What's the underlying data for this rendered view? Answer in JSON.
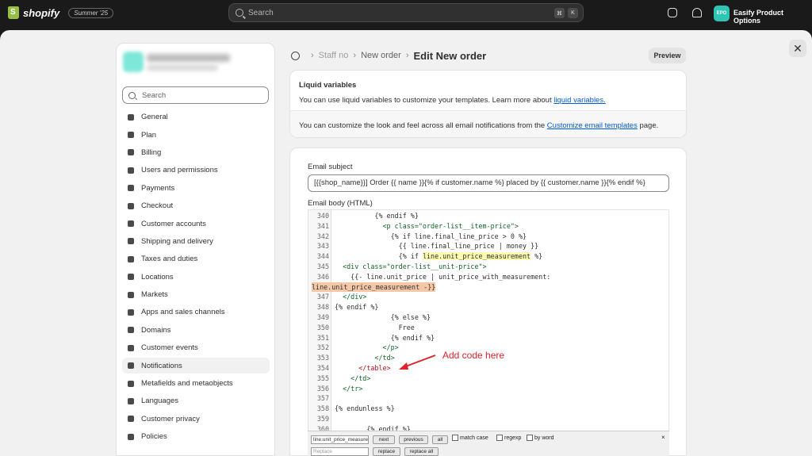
{
  "topbar": {
    "brand": "shopify",
    "edition": "Summer '25",
    "search_placeholder": "Search",
    "kbd_1": "⌘",
    "kbd_2": "K",
    "store_badge": "EPO",
    "store_name": "Easify Product Options"
  },
  "close_label": "✕",
  "sidebar": {
    "search_placeholder": "Search",
    "items": [
      {
        "label": "General"
      },
      {
        "label": "Plan"
      },
      {
        "label": "Billing"
      },
      {
        "label": "Users and permissions"
      },
      {
        "label": "Payments"
      },
      {
        "label": "Checkout"
      },
      {
        "label": "Customer accounts"
      },
      {
        "label": "Shipping and delivery"
      },
      {
        "label": "Taxes and duties"
      },
      {
        "label": "Locations"
      },
      {
        "label": "Markets"
      },
      {
        "label": "Apps and sales channels"
      },
      {
        "label": "Domains"
      },
      {
        "label": "Customer events"
      },
      {
        "label": "Notifications"
      },
      {
        "label": "Metafields and metaobjects"
      },
      {
        "label": "Languages"
      },
      {
        "label": "Customer privacy"
      },
      {
        "label": "Policies"
      }
    ],
    "active_item": "Notifications"
  },
  "header": {
    "crumb_1": "Staff no",
    "crumb_2": "New order",
    "title": "Edit New order",
    "preview_label": "Preview"
  },
  "liquid_card": {
    "title": "Liquid variables",
    "line1_text": "You can use liquid variables to customize your templates. Learn more about ",
    "line1_link": "liquid variables.",
    "line2_text": "You can customize the look and feel across all email notifications from the ",
    "line2_link": "Customize email templates",
    "line2_suffix": " page."
  },
  "email": {
    "subject_label": "Email subject",
    "subject_value": "[{{shop_name}}] Order {{ name }}{% if customer.name %} placed by {{ customer.name }}{% endif %}",
    "body_label": "Email body (HTML)"
  },
  "code_lines": [
    {
      "n": "340",
      "t": "          {% endif %}"
    },
    {
      "n": "341",
      "t": "            <p class=\"order-list__item-price\">"
    },
    {
      "n": "342",
      "t": "              {% if line.final_line_price > 0 %}"
    },
    {
      "n": "343",
      "t": "                {{ line.final_line_price | money }}"
    },
    {
      "n": "344",
      "t": "                {% if line.unit_price_measurement %}"
    },
    {
      "n": "345",
      "t": "  <div class=\"order-list__unit-price\">"
    },
    {
      "n": "346",
      "t": "    {{- line.unit_price | unit_price_with_measurement:"
    },
    {
      "n": "",
      "t": "line.unit_price_measurement -}}"
    },
    {
      "n": "347",
      "t": "  </div>"
    },
    {
      "n": "348",
      "t": "{% endif %}"
    },
    {
      "n": "349",
      "t": "              {% else %}"
    },
    {
      "n": "350",
      "t": "                Free"
    },
    {
      "n": "351",
      "t": "              {% endif %}"
    },
    {
      "n": "352",
      "t": "            </p>"
    },
    {
      "n": "353",
      "t": "          </td>"
    },
    {
      "n": "354",
      "t": "      </table>"
    },
    {
      "n": "355",
      "t": "    </td>"
    },
    {
      "n": "356",
      "t": "  </tr>"
    },
    {
      "n": "357",
      "t": ""
    },
    {
      "n": "358",
      "t": "{% endunless %}"
    },
    {
      "n": "359",
      "t": ""
    },
    {
      "n": "360",
      "t": "        {% endif %}"
    }
  ],
  "annotation": "Add code here",
  "findbar": {
    "find_value": "line.unit_price_measure",
    "next": "next",
    "previous": "previous",
    "all": "all",
    "match_case": "match case",
    "regexp": "regexp",
    "by_word": "by word",
    "close": "×",
    "replace_placeholder": "Replace",
    "replace": "replace",
    "replace_all": "replace all"
  },
  "colors": {
    "accent_link": "#005bd3",
    "annotation_red": "#e0222b",
    "store_badge": "#2ec4b6"
  }
}
